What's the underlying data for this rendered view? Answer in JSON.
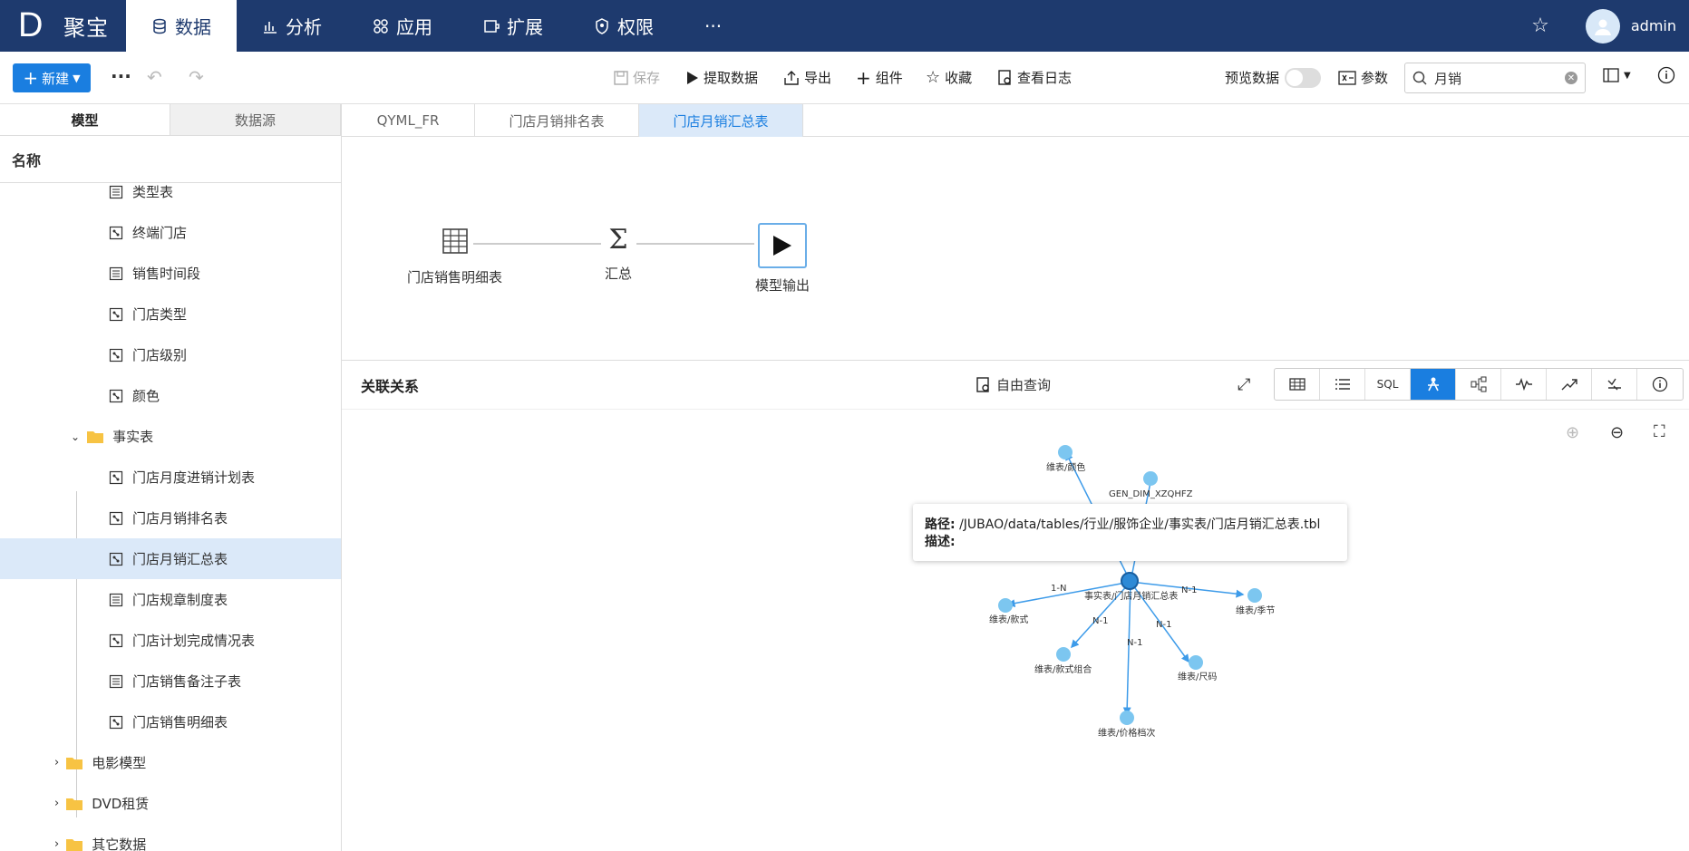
{
  "app": {
    "logo_letter": "D",
    "name": "聚宝",
    "user": "admin"
  },
  "nav": [
    {
      "label": "数据",
      "icon": "database-icon"
    },
    {
      "label": "分析",
      "icon": "bar-chart-icon"
    },
    {
      "label": "应用",
      "icon": "apps-icon"
    },
    {
      "label": "扩展",
      "icon": "extension-icon"
    },
    {
      "label": "权限",
      "icon": "shield-icon"
    },
    {
      "label": "···",
      "icon": "more-icon"
    }
  ],
  "toolbar": {
    "new_label": "新建",
    "save": "保存",
    "extract": "提取数据",
    "export": "导出",
    "component": "组件",
    "favorite": "收藏",
    "log": "查看日志",
    "preview": "预览数据",
    "params": "参数",
    "search_value": "月销"
  },
  "sidebar": {
    "tabs": [
      "模型",
      "数据源"
    ],
    "header": "名称",
    "items": [
      "类型表",
      "终端门店",
      "销售时间段",
      "门店类型",
      "门店级别",
      "颜色",
      "事实表",
      "门店月度进销计划表",
      "门店月销排名表",
      "门店月销汇总表",
      "门店规章制度表",
      "门店计划完成情况表",
      "门店销售备注子表",
      "门店销售明细表",
      "电影模型",
      "DVD租赁",
      "其它数据"
    ]
  },
  "tabs": [
    "QYML_FR",
    "门店月销排名表",
    "门店月销汇总表"
  ],
  "flow": {
    "nodes": [
      "门店销售明细表",
      "汇总",
      "模型输出"
    ]
  },
  "relation": {
    "title": "关联关系",
    "free_query": "自由查询",
    "view_modes": [
      "table",
      "list",
      "SQL",
      "relation",
      "tree",
      "pulse",
      "trend",
      "compare",
      "info"
    ]
  },
  "graph": {
    "center": "事实表/门店月销汇总表",
    "nodes": [
      "维表/颜色",
      "GEN_DIM_XZQHFZ",
      "维表/款式",
      "维表/款式组合",
      "维表/价格档次",
      "维表/尺码",
      "维表/季节"
    ],
    "edge_labels": [
      "1-N",
      "N-1",
      "N-1",
      "N-1",
      "N-1"
    ]
  },
  "tooltip": {
    "path_label": "路径:",
    "path_value": "/JUBAO/data/tables/行业/服饰企业/事实表/门店月销汇总表.tbl",
    "desc_label": "描述:"
  }
}
